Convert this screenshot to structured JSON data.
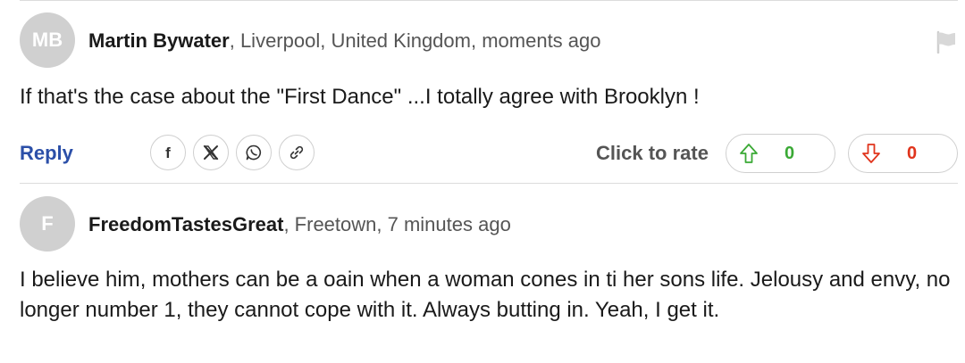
{
  "comments": [
    {
      "initials": "MB",
      "author": "Martin Bywater",
      "location_time": ", Liverpool, United Kingdom, moments ago",
      "text": "If that's the case about the \"First Dance\" ...I totally agree with Brooklyn !",
      "reply_label": "Reply",
      "rate_label": "Click to rate",
      "upvotes": "0",
      "downvotes": "0"
    },
    {
      "initials": "F",
      "author": "FreedomTastesGreat",
      "location_time": ", Freetown, 7 minutes ago",
      "text": "I believe him, mothers can be a oain when a woman cones in ti her sons life. Jelousy and envy, no longer number 1, they cannot cope with it. Always butting in. Yeah, I get it."
    }
  ],
  "share_icons": [
    "facebook-icon",
    "x-icon",
    "whatsapp-icon",
    "link-icon"
  ],
  "colors": {
    "reply": "#2b4fa8",
    "upvote": "#3aa935",
    "downvote": "#e0341c",
    "avatar_bg": "#d0d0d0"
  }
}
